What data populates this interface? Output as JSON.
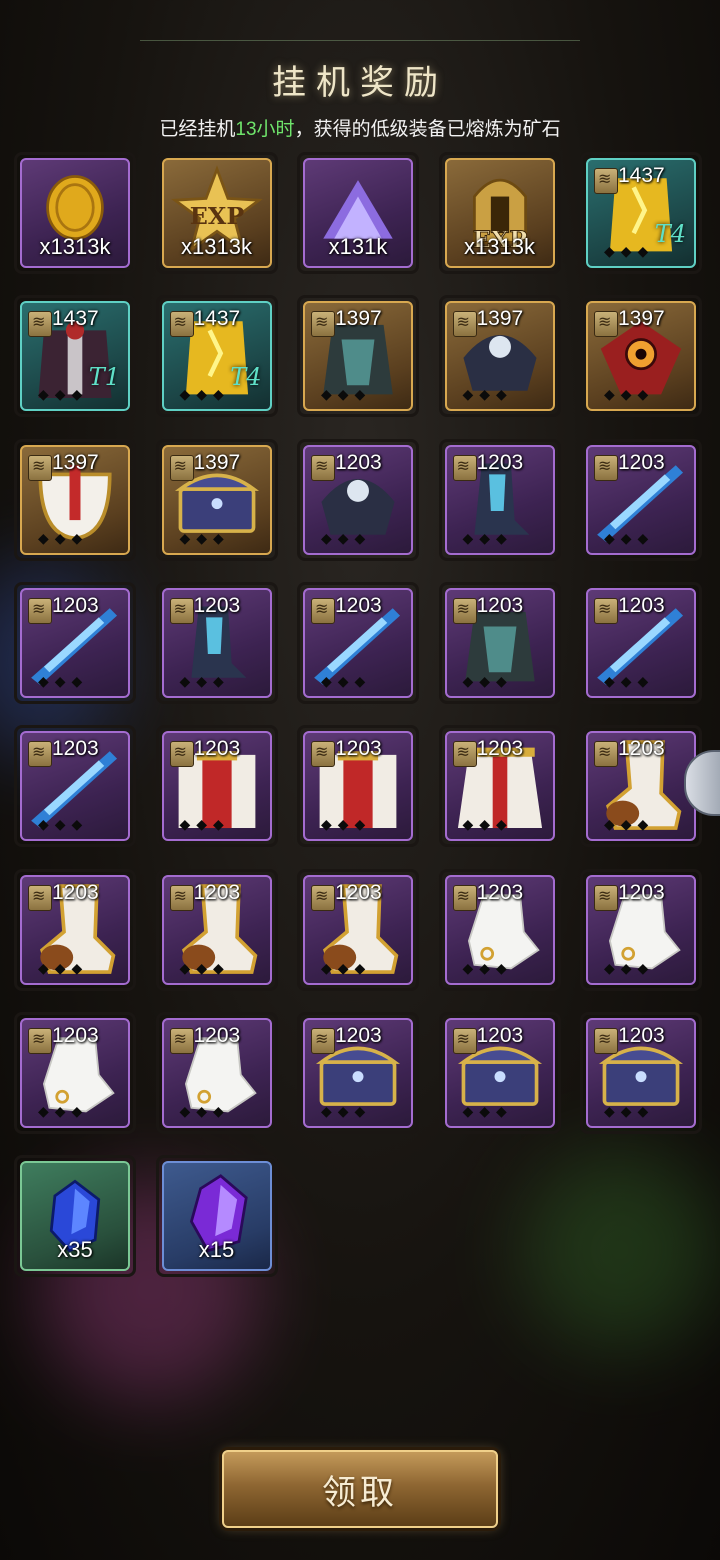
{
  "header": {
    "title": "挂机奖励",
    "subtitle_pre": "已经挂机",
    "subtitle_hours": "13小时",
    "subtitle_post": "，获得的低级装备已熔炼为矿石"
  },
  "items": [
    {
      "name": "gold-coin",
      "rarity": "purple",
      "count": "x1313k"
    },
    {
      "name": "exp-star",
      "rarity": "gold",
      "count": "x1313k"
    },
    {
      "name": "purple-dust",
      "rarity": "purple",
      "count": "x131k"
    },
    {
      "name": "exp-helmet",
      "rarity": "gold",
      "count": "x1313k"
    },
    {
      "name": "gear-cape-gold",
      "rarity": "teal",
      "level": "1437",
      "tier": "T4"
    },
    {
      "name": "gear-robe-red",
      "rarity": "teal",
      "level": "1437",
      "tier": "T1"
    },
    {
      "name": "gear-cape-gold",
      "rarity": "teal",
      "level": "1437",
      "tier": "T4"
    },
    {
      "name": "gear-dark-armor",
      "rarity": "gold",
      "level": "1397"
    },
    {
      "name": "gear-dark-shoulder",
      "rarity": "gold",
      "level": "1397"
    },
    {
      "name": "gear-red-eye",
      "rarity": "gold",
      "level": "1397"
    },
    {
      "name": "gear-white-pauldron",
      "rarity": "gold",
      "level": "1397"
    },
    {
      "name": "gear-chest",
      "rarity": "gold",
      "level": "1397"
    },
    {
      "name": "gear-dark-shoulder",
      "rarity": "purple",
      "level": "1203"
    },
    {
      "name": "gear-dark-boots",
      "rarity": "purple",
      "level": "1203"
    },
    {
      "name": "gear-blue-sword",
      "rarity": "purple",
      "level": "1203"
    },
    {
      "name": "gear-blue-sword",
      "rarity": "purple",
      "level": "1203"
    },
    {
      "name": "gear-dark-boots",
      "rarity": "purple",
      "level": "1203"
    },
    {
      "name": "gear-blue-sword",
      "rarity": "purple",
      "level": "1203"
    },
    {
      "name": "gear-dark-armor",
      "rarity": "purple",
      "level": "1203"
    },
    {
      "name": "gear-blue-sword",
      "rarity": "purple",
      "level": "1203"
    },
    {
      "name": "gear-blue-sword",
      "rarity": "purple",
      "level": "1203"
    },
    {
      "name": "gear-holy-robe",
      "rarity": "purple",
      "level": "1203"
    },
    {
      "name": "gear-holy-robe",
      "rarity": "purple",
      "level": "1203"
    },
    {
      "name": "gear-holy-skirt",
      "rarity": "purple",
      "level": "1203"
    },
    {
      "name": "gear-white-boots",
      "rarity": "purple",
      "level": "1203"
    },
    {
      "name": "gear-white-boots",
      "rarity": "purple",
      "level": "1203"
    },
    {
      "name": "gear-white-boots",
      "rarity": "purple",
      "level": "1203"
    },
    {
      "name": "gear-white-boots",
      "rarity": "purple",
      "level": "1203"
    },
    {
      "name": "gear-white-glove",
      "rarity": "purple",
      "level": "1203"
    },
    {
      "name": "gear-white-glove",
      "rarity": "purple",
      "level": "1203"
    },
    {
      "name": "gear-white-glove",
      "rarity": "purple",
      "level": "1203"
    },
    {
      "name": "gear-white-glove",
      "rarity": "purple",
      "level": "1203"
    },
    {
      "name": "gear-chest",
      "rarity": "purple",
      "level": "1203"
    },
    {
      "name": "gear-chest",
      "rarity": "purple",
      "level": "1203"
    },
    {
      "name": "gear-chest",
      "rarity": "purple",
      "level": "1203"
    },
    {
      "name": "blue-ore",
      "rarity": "green",
      "count": "x35"
    },
    {
      "name": "purple-ore",
      "rarity": "blue",
      "count": "x15"
    }
  ],
  "claim_button": "领取"
}
